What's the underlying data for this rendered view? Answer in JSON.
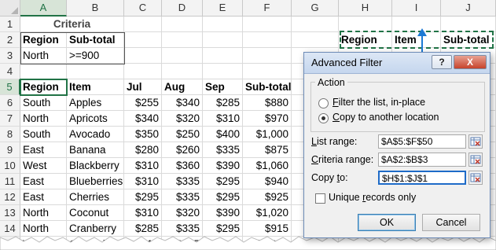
{
  "columns": [
    "A",
    "B",
    "C",
    "D",
    "E",
    "F",
    "G",
    "H",
    "I",
    "J"
  ],
  "rows": [
    "1",
    "2",
    "3",
    "4",
    "5",
    "6",
    "7",
    "8",
    "9",
    "10",
    "11",
    "12",
    "13",
    "14",
    "15"
  ],
  "cells": {
    "A1": "Criteria",
    "A2": "Region",
    "B2": "Sub-total",
    "A3": "North",
    "B3": ">=900",
    "A5": "Region",
    "B5": "Item",
    "C5": "Jul",
    "D5": "Aug",
    "E5": "Sep",
    "F5": "Sub-total",
    "H2": "Region",
    "I2": "Item",
    "J2": "Sub-total"
  },
  "data_rows": [
    [
      "South",
      "Apples",
      "$255",
      "$340",
      "$285",
      "$880"
    ],
    [
      "North",
      "Apricots",
      "$340",
      "$320",
      "$310",
      "$970"
    ],
    [
      "South",
      "Avocado",
      "$350",
      "$250",
      "$400",
      "$1,000"
    ],
    [
      "East",
      "Banana",
      "$280",
      "$260",
      "$335",
      "$875"
    ],
    [
      "West",
      "Blackberry",
      "$310",
      "$360",
      "$390",
      "$1,060"
    ],
    [
      "East",
      "Blueberries",
      "$310",
      "$335",
      "$295",
      "$940"
    ],
    [
      "East",
      "Cherries",
      "$295",
      "$335",
      "$295",
      "$925"
    ],
    [
      "North",
      "Coconut",
      "$310",
      "$320",
      "$390",
      "$1,020"
    ],
    [
      "North",
      "Cranberry",
      "$285",
      "$335",
      "$295",
      "$915"
    ],
    [
      "West",
      "Cucumber",
      "$310",
      "$345",
      "$390",
      "$1,045"
    ]
  ],
  "dialog": {
    "title": "Advanced Filter",
    "help": "?",
    "close": "X",
    "action_label": "Action",
    "opt1_u": "F",
    "opt1_rest": "ilter the list, in-place",
    "opt2_u": "C",
    "opt2_rest": "opy to another location",
    "list_range_u": "L",
    "list_range_rest": "ist range:",
    "list_range_value": "$A$5:$F$50",
    "criteria_u": "C",
    "criteria_rest": "riteria range:",
    "criteria_value": "$A$2:$B$3",
    "copyto_pre": "Copy ",
    "copyto_u": "t",
    "copyto_rest": "o:",
    "copyto_value": "$H$1:$J$1",
    "unique_pre": "Unique ",
    "unique_u": "r",
    "unique_rest": "ecords only",
    "ok": "OK",
    "cancel": "Cancel"
  },
  "colors": {
    "accent": "#217346",
    "arrow": "#1c79d4"
  }
}
